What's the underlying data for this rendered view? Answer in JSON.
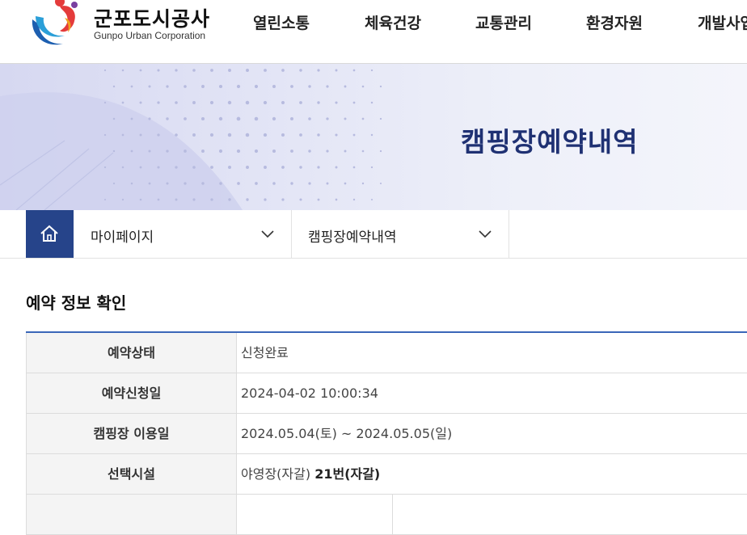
{
  "logo": {
    "name": "군포도시공사",
    "subtitle": "Gunpo Urban Corporation",
    "icon": "gunpo-logo-icon"
  },
  "nav": {
    "items": [
      "열린소통",
      "체육건강",
      "교통관리",
      "환경자원",
      "개발사업"
    ]
  },
  "banner": {
    "title": "캠핑장예약내역"
  },
  "location": {
    "home_icon": "home-icon",
    "level1": "마이페이지",
    "level2": "캠핑장예약내역"
  },
  "section": {
    "title": "예약 정보 확인"
  },
  "reservation": {
    "rows": [
      {
        "label": "예약상태",
        "value": "신청완료"
      },
      {
        "label": "예약신청일",
        "value": "2024-04-02 10:00:34"
      },
      {
        "label": "캠핑장 이용일",
        "value": "2024.05.04(토) ~ 2024.05.05(일)"
      },
      {
        "label": "선택시설",
        "value": "야영장(자갈)",
        "value_bold": "21번(자갈)"
      }
    ]
  },
  "colors": {
    "brand_navy": "#26448a",
    "title_navy": "#1f3173",
    "table_border": "#3a66b8",
    "banner_bg": "#dfe1f4"
  }
}
